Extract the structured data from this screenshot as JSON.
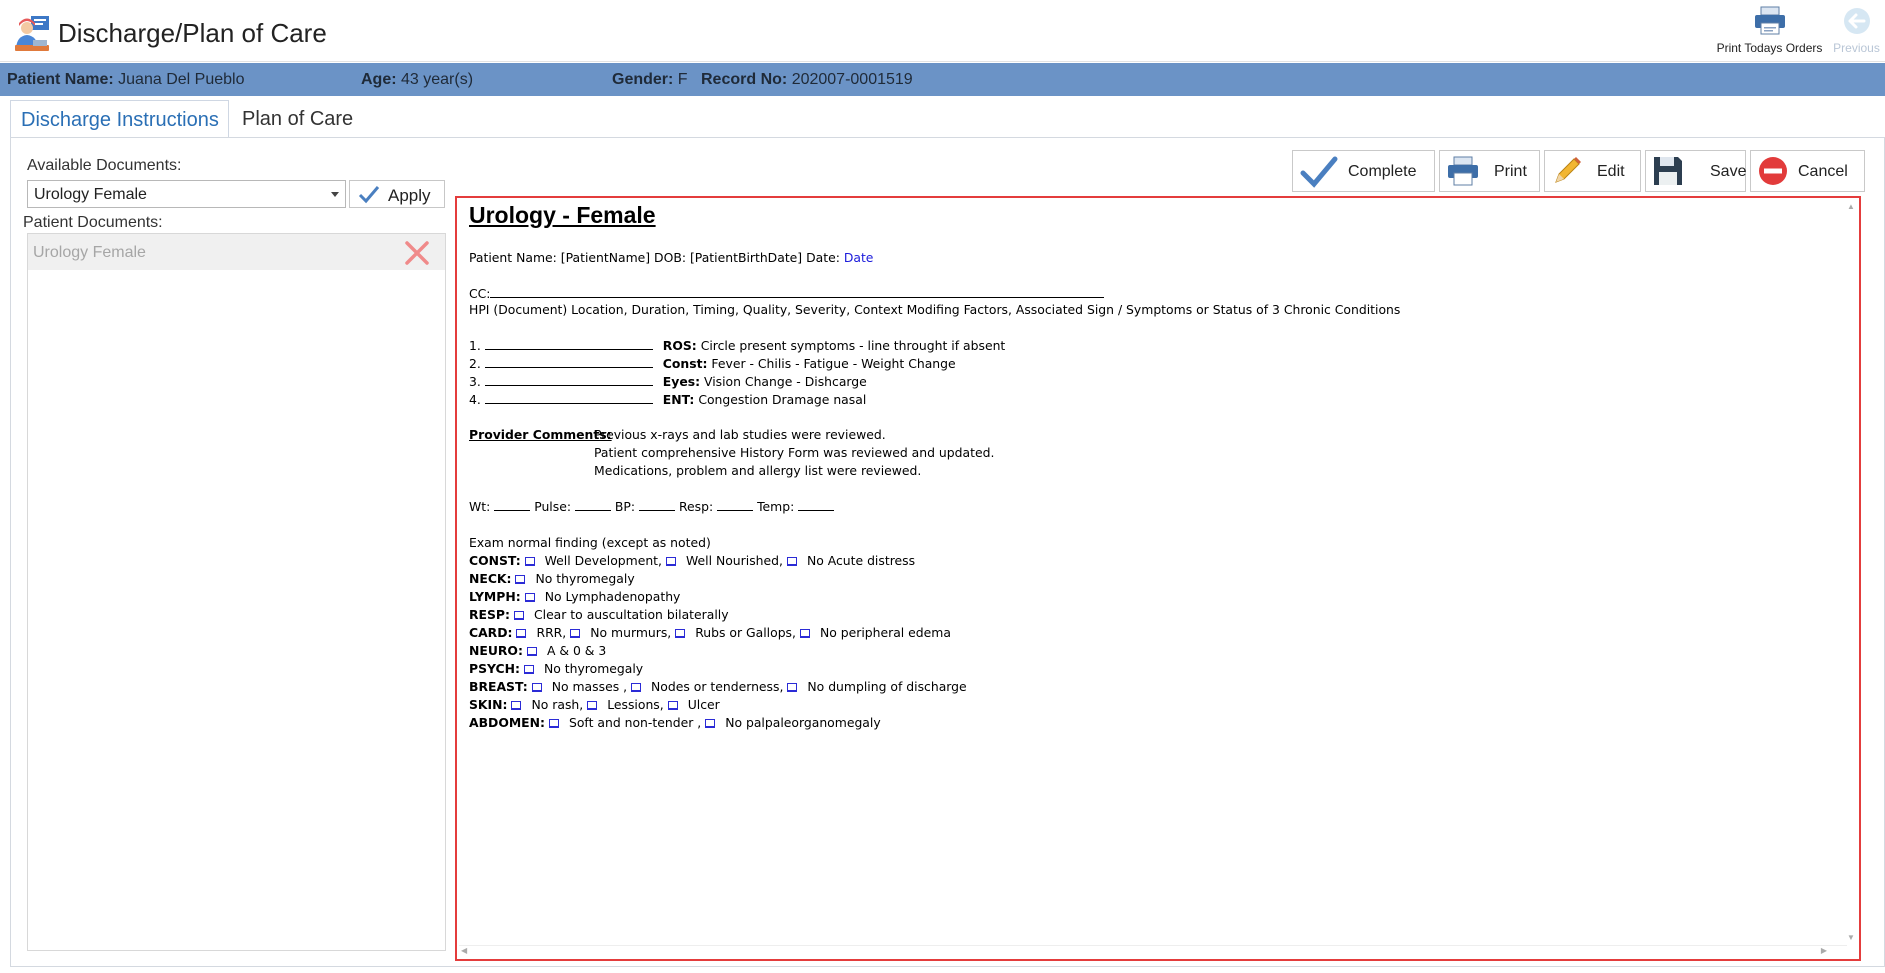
{
  "window": {
    "title": "Discharge/Plan of Care"
  },
  "toolbar": {
    "print_orders": "Print Todays Orders",
    "previous": "Previous"
  },
  "patient": {
    "name_label": "Patient Name:",
    "name": "Juana Del Pueblo",
    "age_label": "Age:",
    "age": "43 year(s)",
    "gender_label": "Gender:",
    "gender": "F",
    "record_label": "Record No:",
    "record": "202007-0001519"
  },
  "tabs": [
    {
      "label": "Discharge Instructions"
    },
    {
      "label": "Plan of Care"
    }
  ],
  "left": {
    "available_label": "Available Documents:",
    "selected_document": "Urology Female",
    "apply_label": "Apply",
    "patient_docs_label": "Patient Documents:",
    "patient_docs": [
      "Urology Female"
    ]
  },
  "actions": {
    "complete": "Complete",
    "print": "Print",
    "edit": "Edit",
    "save": "Save",
    "cancel": "Cancel"
  },
  "document": {
    "title": "Urology - Female",
    "header_line": "Patient Name: [PatientName] DOB: [PatientBirthDate] Date: ",
    "date_token": "Date",
    "cc_label": "CC:",
    "hpi": "HPI (Document) Location, Duration, Timing, Quality, Severity, Context Modifing Factors, Associated Sign / Symptoms or Status of 3 Chronic Conditions",
    "ros": [
      {
        "num": "1.",
        "label": "ROS:",
        "text": "Circle present symptoms - line throught if absent"
      },
      {
        "num": "2.",
        "label": "Const:",
        "text": "Fever - Chilis - Fatigue - Weight Change"
      },
      {
        "num": "3.",
        "label": "Eyes:",
        "text": "Vision Change - Dishcarge"
      },
      {
        "num": "4.",
        "label": "ENT:",
        "text": "Congestion Dramage nasal"
      }
    ],
    "provider_label": "Provider Comments:",
    "provider_lines": [
      "Previous x-rays and lab studies were reviewed.",
      "Patient comprehensive History Form was reviewed and updated.",
      "Medications, problem and allergy list were reviewed."
    ],
    "vitals": {
      "wt": "Wt:",
      "pulse": "Pulse:",
      "bp": "BP:",
      "resp": "Resp:",
      "temp": "Temp:"
    },
    "exam_heading": "Exam normal finding (except as noted)",
    "exam": [
      {
        "label": "CONST:",
        "items": [
          "Well Development,",
          "Well Nourished,",
          "No Acute distress"
        ]
      },
      {
        "label": "NECK:",
        "items": [
          "No thyromegaly"
        ]
      },
      {
        "label": "LYMPH:",
        "items": [
          "No Lymphadenopathy"
        ]
      },
      {
        "label": "RESP:",
        "items": [
          "Clear to auscultation bilaterally"
        ]
      },
      {
        "label": "CARD:",
        "items": [
          "RRR,",
          "No murmurs,",
          "Rubs or Gallops,",
          "No peripheral edema"
        ]
      },
      {
        "label": "NEURO:",
        "items": [
          "A & 0 & 3"
        ]
      },
      {
        "label": "PSYCH:",
        "items": [
          "No thyromegaly"
        ]
      },
      {
        "label": "BREAST:",
        "items": [
          "No masses ,",
          "Nodes or tenderness,",
          "No dumpling of discharge"
        ]
      },
      {
        "label": "SKIN:",
        "items": [
          "No rash,",
          "Lessions,",
          "Ulcer"
        ]
      },
      {
        "label": "ABDOMEN:",
        "items": [
          "Soft and non-tender ,",
          "No palpaleorganomegaly"
        ]
      }
    ]
  },
  "colors": {
    "patient_bar": "#6b93c6",
    "accent": "#2a6fb5",
    "doc_border": "#e43c3c",
    "checkbox": "#2b2bd6"
  }
}
